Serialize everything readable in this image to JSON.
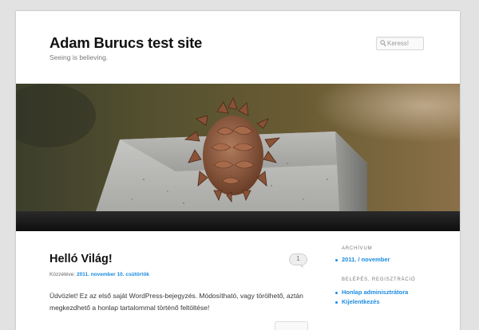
{
  "header": {
    "site_title": "Adam Burucs test site",
    "site_description": "Seeing is believing."
  },
  "search": {
    "placeholder": "Keress!",
    "icon": "search-icon"
  },
  "post": {
    "title": "Helló Világ!",
    "comment_count": "1",
    "meta_prefix": "Közzétéve:",
    "meta_date": "2011. november 10. csütörtök",
    "body": "Üdvözlet! Ez az első saját WordPress-bejegyzés. Módosítható, vagy törölhető, aztán megkezdhető a honlap tartalommal történő feltöltése!"
  },
  "sidebar": {
    "archive_title": "ARCHÍVUM",
    "archive_items": [
      {
        "label": "2011. / november"
      }
    ],
    "meta_title": "BELÉPÉS, REGISZTRÁCIÓ",
    "meta_items": [
      {
        "label": "Honlap adminisztrátora"
      },
      {
        "label": "Kijelentkezés"
      }
    ]
  },
  "colors": {
    "link": "#1b8be0",
    "title": "#111111",
    "background": "#e2e2e2"
  }
}
